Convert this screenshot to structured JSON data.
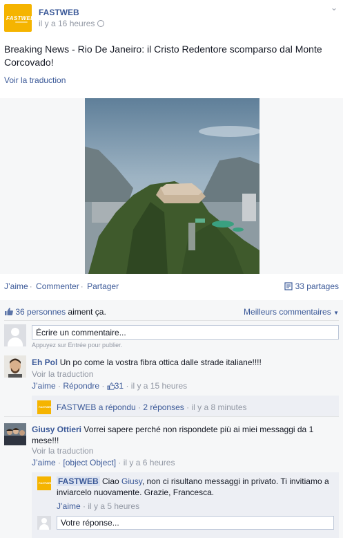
{
  "post": {
    "page_name": "FASTWEB",
    "logo_text": "FASTWEB",
    "timestamp": "il y a 16 heures",
    "audience_icon": "globe-icon",
    "options_icon": "chevron-down-icon",
    "text": "Breaking News - Rio De Janeiro: il Cristo Redentore scomparso dal Monte Corcovado!",
    "see_translation": "Voir la traduction"
  },
  "actions": {
    "like": "J’aime",
    "comment": "Commenter",
    "share": "Partager",
    "shares_count": "33 partages",
    "shares_icon": "share-icon"
  },
  "likes": {
    "icon": "thumbs-up-icon",
    "people_link": "36 personnes",
    "suffix": "aiment ça.",
    "sort_label": "Meilleurs commentaires",
    "sort_icon": "caret-down-icon"
  },
  "composer": {
    "placeholder": "Écrire un commentaire...",
    "hint": "Appuyez sur Entrée pour publier."
  },
  "comments": [
    {
      "author": "Eh Pol",
      "text": "Un po come la vostra fibra ottica dalle strade italiane!!!!",
      "see_translation": "Voir la traduction",
      "like": "J’aime",
      "reply": "Répondre",
      "like_count": "31",
      "time": "il y a 15 heures",
      "reply_summary": {
        "author": "FASTWEB",
        "action": "a répondu",
        "count": "2 réponses",
        "time": "il y a 8 minutes"
      }
    },
    {
      "author": "Giusy Ottieri",
      "text": "Vorrei sapere perché non rispondete più ai miei messaggi da 1 mese!!!",
      "see_translation": "Voir la traduction",
      "like": "J’aime",
      "reply": {
        "author": "FASTWEB",
        "text_before": "Ciao ",
        "tagged": "Giusy",
        "text_after": ", non ci risultano messaggi in privato. Ti invitiamo a inviarcelo nuovamente. Grazie, Francesca.",
        "like": "J’aime",
        "time": "il y a 5 heures"
      },
      "time": "il y a 6 heures"
    }
  ],
  "reply_composer": {
    "placeholder": "Votre réponse..."
  },
  "colors": {
    "link": "#3b5998",
    "brand": "#f5b400",
    "muted": "#9197a3"
  }
}
